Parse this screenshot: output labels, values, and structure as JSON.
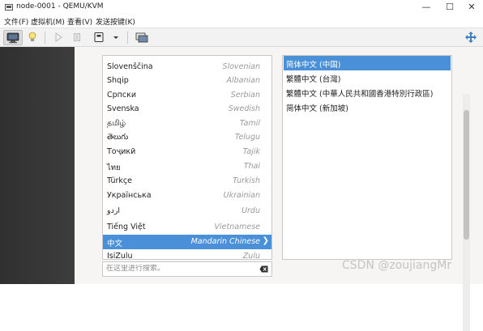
{
  "window": {
    "title": "node-0001 - QEMU/KVM",
    "controls": {
      "minimize": "—",
      "maximize": "☐",
      "close": "✕"
    }
  },
  "menubar": {
    "items": [
      {
        "label": "文件(F)"
      },
      {
        "label": "虚拟机(M)"
      },
      {
        "label": "查看(V)"
      },
      {
        "label": "发送按键(K)"
      }
    ]
  },
  "toolbar": {
    "buttons": [
      {
        "icon": "monitor-icon",
        "active": true
      },
      {
        "icon": "lightbulb-icon",
        "active": false
      },
      {
        "icon": "play-icon",
        "active": false
      },
      {
        "icon": "pause-icon",
        "active": false
      },
      {
        "icon": "power-icon",
        "active": false
      },
      {
        "icon": "chevron-down-icon",
        "active": false
      },
      {
        "icon": "screenshot-icon",
        "active": false
      },
      {
        "icon": "resize-icon",
        "active": false
      }
    ]
  },
  "language_list": {
    "items": [
      {
        "native": "Slovenščina",
        "english": "Slovenian"
      },
      {
        "native": "Shqip",
        "english": "Albanian"
      },
      {
        "native": "Српски",
        "english": "Serbian"
      },
      {
        "native": "Svenska",
        "english": "Swedish"
      },
      {
        "native": "தமிழ்",
        "english": "Tamil"
      },
      {
        "native": "తెలుగు",
        "english": "Telugu"
      },
      {
        "native": "Тоҷикӣ",
        "english": "Tajik"
      },
      {
        "native": "ไทย",
        "english": "Thai"
      },
      {
        "native": "Türkçe",
        "english": "Turkish"
      },
      {
        "native": "Українська",
        "english": "Ukrainian"
      },
      {
        "native": "اردو",
        "english": "Urdu"
      },
      {
        "native": "Tiếng Việt",
        "english": "Vietnamese"
      },
      {
        "native": "中文",
        "english": "Mandarin Chinese",
        "selected": true
      },
      {
        "native": "IsiZulu",
        "english": "Zulu"
      }
    ],
    "selected_arrow": "❯"
  },
  "search": {
    "placeholder": "在这里进行搜索。",
    "value": "",
    "clear_icon": "backspace-icon"
  },
  "variant_list": {
    "items": [
      {
        "label": "简体中文 (中国)",
        "selected": true
      },
      {
        "label": "繁體中文 (台灣)"
      },
      {
        "label": "繁體中文 (中華人民共和國香港特別行政區)"
      },
      {
        "label": "简体中文 (新加坡)"
      }
    ]
  },
  "colors": {
    "selection": "#4a90d9",
    "sidebar_dark": "#353535",
    "content_bg": "#f6f5f4"
  },
  "watermark": "CSDN @zoujiangMr"
}
